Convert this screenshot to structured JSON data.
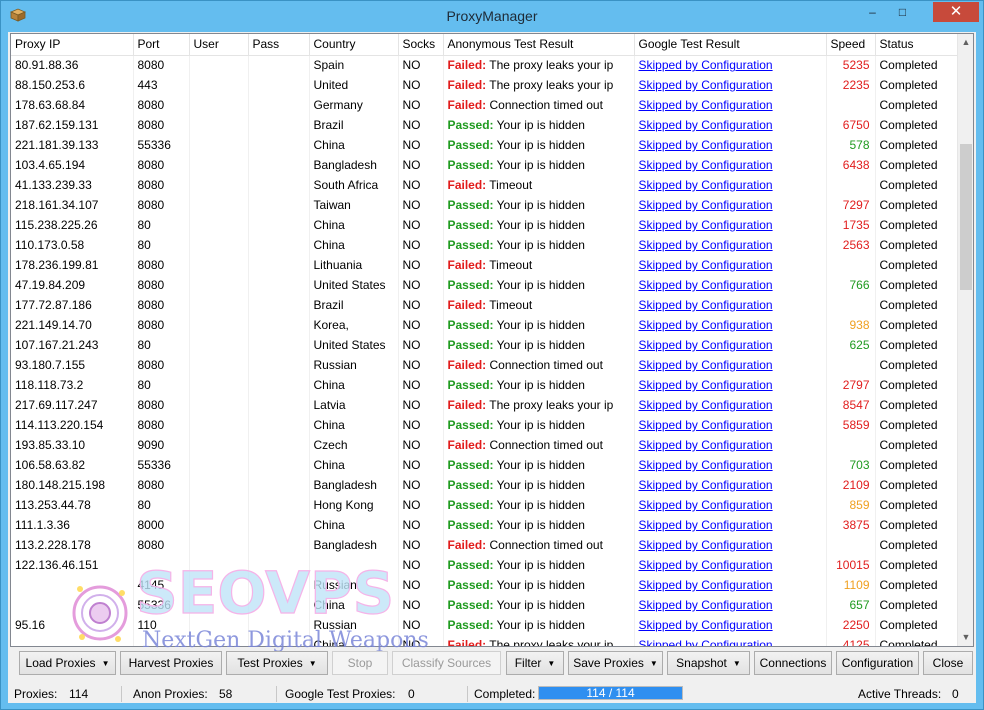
{
  "window": {
    "title": "ProxyManager",
    "minimize_glyph": "–",
    "maximize_glyph": "□",
    "close_glyph": "✕"
  },
  "columns": [
    "Proxy IP",
    "Port",
    "User",
    "Pass",
    "Country",
    "Socks",
    "Anonymous Test Result",
    "Google Test Result",
    "Speed",
    "Status"
  ],
  "rows": [
    {
      "ip": "80.91.88.36",
      "port": "8080",
      "user": "",
      "pass": "",
      "country": "Spain",
      "socks": "NO",
      "anon_status": "Failed:",
      "anon_msg": "The proxy leaks your ip",
      "google": "Skipped by Configuration",
      "speed": "5235",
      "speed_level": "red",
      "status": "Completed"
    },
    {
      "ip": "88.150.253.6",
      "port": "443",
      "user": "",
      "pass": "",
      "country": "United",
      "socks": "NO",
      "anon_status": "Failed:",
      "anon_msg": "The proxy leaks your ip",
      "google": "Skipped by Configuration",
      "speed": "2235",
      "speed_level": "red",
      "status": "Completed"
    },
    {
      "ip": "178.63.68.84",
      "port": "8080",
      "user": "",
      "pass": "",
      "country": "Germany",
      "socks": "NO",
      "anon_status": "Failed:",
      "anon_msg": "Connection timed out",
      "google": "Skipped by Configuration",
      "speed": "",
      "speed_level": "",
      "status": "Completed"
    },
    {
      "ip": "187.62.159.131",
      "port": "8080",
      "user": "",
      "pass": "",
      "country": "Brazil",
      "socks": "NO",
      "anon_status": "Passed:",
      "anon_msg": "Your ip is hidden",
      "google": "Skipped by Configuration",
      "speed": "6750",
      "speed_level": "red",
      "status": "Completed"
    },
    {
      "ip": "221.181.39.133",
      "port": "55336",
      "user": "",
      "pass": "",
      "country": "China",
      "socks": "NO",
      "anon_status": "Passed:",
      "anon_msg": "Your ip is hidden",
      "google": "Skipped by Configuration",
      "speed": "578",
      "speed_level": "green",
      "status": "Completed"
    },
    {
      "ip": "103.4.65.194",
      "port": "8080",
      "user": "",
      "pass": "",
      "country": "Bangladesh",
      "socks": "NO",
      "anon_status": "Passed:",
      "anon_msg": "Your ip is hidden",
      "google": "Skipped by Configuration",
      "speed": "6438",
      "speed_level": "red",
      "status": "Completed"
    },
    {
      "ip": "41.133.239.33",
      "port": "8080",
      "user": "",
      "pass": "",
      "country": "South Africa",
      "socks": "NO",
      "anon_status": "Failed:",
      "anon_msg": "Timeout",
      "google": "Skipped by Configuration",
      "speed": "",
      "speed_level": "",
      "status": "Completed"
    },
    {
      "ip": "218.161.34.107",
      "port": "8080",
      "user": "",
      "pass": "",
      "country": "Taiwan",
      "socks": "NO",
      "anon_status": "Passed:",
      "anon_msg": "Your ip is hidden",
      "google": "Skipped by Configuration",
      "speed": "7297",
      "speed_level": "red",
      "status": "Completed"
    },
    {
      "ip": "115.238.225.26",
      "port": "80",
      "user": "",
      "pass": "",
      "country": "China",
      "socks": "NO",
      "anon_status": "Passed:",
      "anon_msg": "Your ip is hidden",
      "google": "Skipped by Configuration",
      "speed": "1735",
      "speed_level": "red",
      "status": "Completed"
    },
    {
      "ip": "110.173.0.58",
      "port": "80",
      "user": "",
      "pass": "",
      "country": "China",
      "socks": "NO",
      "anon_status": "Passed:",
      "anon_msg": "Your ip is hidden",
      "google": "Skipped by Configuration",
      "speed": "2563",
      "speed_level": "red",
      "status": "Completed"
    },
    {
      "ip": "178.236.199.81",
      "port": "8080",
      "user": "",
      "pass": "",
      "country": "Lithuania",
      "socks": "NO",
      "anon_status": "Failed:",
      "anon_msg": "Timeout",
      "google": "Skipped by Configuration",
      "speed": "",
      "speed_level": "",
      "status": "Completed"
    },
    {
      "ip": "47.19.84.209",
      "port": "8080",
      "user": "",
      "pass": "",
      "country": "United States",
      "socks": "NO",
      "anon_status": "Passed:",
      "anon_msg": "Your ip is hidden",
      "google": "Skipped by Configuration",
      "speed": "766",
      "speed_level": "green",
      "status": "Completed"
    },
    {
      "ip": "177.72.87.186",
      "port": "8080",
      "user": "",
      "pass": "",
      "country": "Brazil",
      "socks": "NO",
      "anon_status": "Failed:",
      "anon_msg": "Timeout",
      "google": "Skipped by Configuration",
      "speed": "",
      "speed_level": "",
      "status": "Completed"
    },
    {
      "ip": "221.149.14.70",
      "port": "8080",
      "user": "",
      "pass": "",
      "country": "Korea,",
      "socks": "NO",
      "anon_status": "Passed:",
      "anon_msg": "Your ip is hidden",
      "google": "Skipped by Configuration",
      "speed": "938",
      "speed_level": "orange",
      "status": "Completed"
    },
    {
      "ip": "107.167.21.243",
      "port": "80",
      "user": "",
      "pass": "",
      "country": "United States",
      "socks": "NO",
      "anon_status": "Passed:",
      "anon_msg": "Your ip is hidden",
      "google": "Skipped by Configuration",
      "speed": "625",
      "speed_level": "green",
      "status": "Completed"
    },
    {
      "ip": "93.180.7.155",
      "port": "8080",
      "user": "",
      "pass": "",
      "country": "Russian",
      "socks": "NO",
      "anon_status": "Failed:",
      "anon_msg": "Connection timed out",
      "google": "Skipped by Configuration",
      "speed": "",
      "speed_level": "",
      "status": "Completed"
    },
    {
      "ip": "118.118.73.2",
      "port": "80",
      "user": "",
      "pass": "",
      "country": "China",
      "socks": "NO",
      "anon_status": "Passed:",
      "anon_msg": "Your ip is hidden",
      "google": "Skipped by Configuration",
      "speed": "2797",
      "speed_level": "red",
      "status": "Completed"
    },
    {
      "ip": "217.69.117.247",
      "port": "8080",
      "user": "",
      "pass": "",
      "country": "Latvia",
      "socks": "NO",
      "anon_status": "Failed:",
      "anon_msg": "The proxy leaks your ip",
      "google": "Skipped by Configuration",
      "speed": "8547",
      "speed_level": "red",
      "status": "Completed"
    },
    {
      "ip": "114.113.220.154",
      "port": "8080",
      "user": "",
      "pass": "",
      "country": "China",
      "socks": "NO",
      "anon_status": "Passed:",
      "anon_msg": "Your ip is hidden",
      "google": "Skipped by Configuration",
      "speed": "5859",
      "speed_level": "red",
      "status": "Completed"
    },
    {
      "ip": "193.85.33.10",
      "port": "9090",
      "user": "",
      "pass": "",
      "country": "Czech",
      "socks": "NO",
      "anon_status": "Failed:",
      "anon_msg": "Connection timed out",
      "google": "Skipped by Configuration",
      "speed": "",
      "speed_level": "",
      "status": "Completed"
    },
    {
      "ip": "106.58.63.82",
      "port": "55336",
      "user": "",
      "pass": "",
      "country": "China",
      "socks": "NO",
      "anon_status": "Passed:",
      "anon_msg": "Your ip is hidden",
      "google": "Skipped by Configuration",
      "speed": "703",
      "speed_level": "green",
      "status": "Completed"
    },
    {
      "ip": "180.148.215.198",
      "port": "8080",
      "user": "",
      "pass": "",
      "country": "Bangladesh",
      "socks": "NO",
      "anon_status": "Passed:",
      "anon_msg": "Your ip is hidden",
      "google": "Skipped by Configuration",
      "speed": "2109",
      "speed_level": "red",
      "status": "Completed"
    },
    {
      "ip": "113.253.44.78",
      "port": "80",
      "user": "",
      "pass": "",
      "country": "Hong Kong",
      "socks": "NO",
      "anon_status": "Passed:",
      "anon_msg": "Your ip is hidden",
      "google": "Skipped by Configuration",
      "speed": "859",
      "speed_level": "orange",
      "status": "Completed"
    },
    {
      "ip": "111.1.3.36",
      "port": "8000",
      "user": "",
      "pass": "",
      "country": "China",
      "socks": "NO",
      "anon_status": "Passed:",
      "anon_msg": "Your ip is hidden",
      "google": "Skipped by Configuration",
      "speed": "3875",
      "speed_level": "red",
      "status": "Completed"
    },
    {
      "ip": "113.2.228.178",
      "port": "8080",
      "user": "",
      "pass": "",
      "country": "Bangladesh",
      "socks": "NO",
      "anon_status": "Failed:",
      "anon_msg": "Connection timed out",
      "google": "Skipped by Configuration",
      "speed": "",
      "speed_level": "",
      "status": "Completed"
    },
    {
      "ip": "122.136.46.151",
      "port": "",
      "user": "",
      "pass": "",
      "country": "",
      "socks": "NO",
      "anon_status": "Passed:",
      "anon_msg": "Your ip is hidden",
      "google": "Skipped by Configuration",
      "speed": "10015",
      "speed_level": "red",
      "status": "Completed"
    },
    {
      "ip": "",
      "port": "4145",
      "user": "",
      "pass": "",
      "country": "Russian",
      "socks": "NO",
      "anon_status": "Passed:",
      "anon_msg": "Your ip is hidden",
      "google": "Skipped by Configuration",
      "speed": "1109",
      "speed_level": "orange",
      "status": "Completed"
    },
    {
      "ip": "",
      "port": "55336",
      "user": "",
      "pass": "",
      "country": "China",
      "socks": "NO",
      "anon_status": "Passed:",
      "anon_msg": "Your ip is hidden",
      "google": "Skipped by Configuration",
      "speed": "657",
      "speed_level": "green",
      "status": "Completed"
    },
    {
      "ip": "95.16",
      "port": "110",
      "user": "",
      "pass": "",
      "country": "Russian",
      "socks": "NO",
      "anon_status": "Passed:",
      "anon_msg": "Your ip is hidden",
      "google": "Skipped by Configuration",
      "speed": "2250",
      "speed_level": "red",
      "status": "Completed"
    },
    {
      "ip": "",
      "port": "",
      "user": "",
      "pass": "",
      "country": "China",
      "socks": "NO",
      "anon_status": "Failed:",
      "anon_msg": "The proxy leaks your ip",
      "google": "Skipped by Configuration",
      "speed": "4125",
      "speed_level": "red",
      "status": "Completed"
    }
  ],
  "watermark": {
    "brand": "SEOVPS",
    "tagline": "NextGen Digital Weapons"
  },
  "toolbar": {
    "load_proxies": "Load Proxies",
    "harvest_proxies": "Harvest Proxies",
    "test_proxies": "Test Proxies",
    "stop": "Stop",
    "classify_sources": "Classify Sources",
    "filter": "Filter",
    "save_proxies": "Save Proxies",
    "snapshot": "Snapshot",
    "connections": "Connections",
    "configuration": "Configuration",
    "close": "Close",
    "dropdown_glyph": "▼"
  },
  "status": {
    "proxies_label": "Proxies:",
    "proxies_value": "114",
    "anon_label": "Anon Proxies:",
    "anon_value": "58",
    "google_label": "Google Test Proxies:",
    "google_value": "0",
    "completed_label": "Completed:",
    "completed_text": "114 / 114",
    "completed_fraction": 1.0,
    "threads_label": "Active Threads:",
    "threads_value": "0"
  },
  "colors": {
    "passed": "#1f9a1f",
    "failed": "#e11c1c",
    "link": "#0000ff",
    "speed_slow": "#e11c1c",
    "speed_fast": "#1f9a1f",
    "speed_medium": "#f0a020",
    "progress": "#2f8ff0",
    "close_button": "#c74a3b"
  },
  "icons": {
    "app": "box-icon",
    "scroll_up": "chevron-up-icon",
    "scroll_down": "chevron-down-icon",
    "dropdown": "caret-down-icon"
  }
}
